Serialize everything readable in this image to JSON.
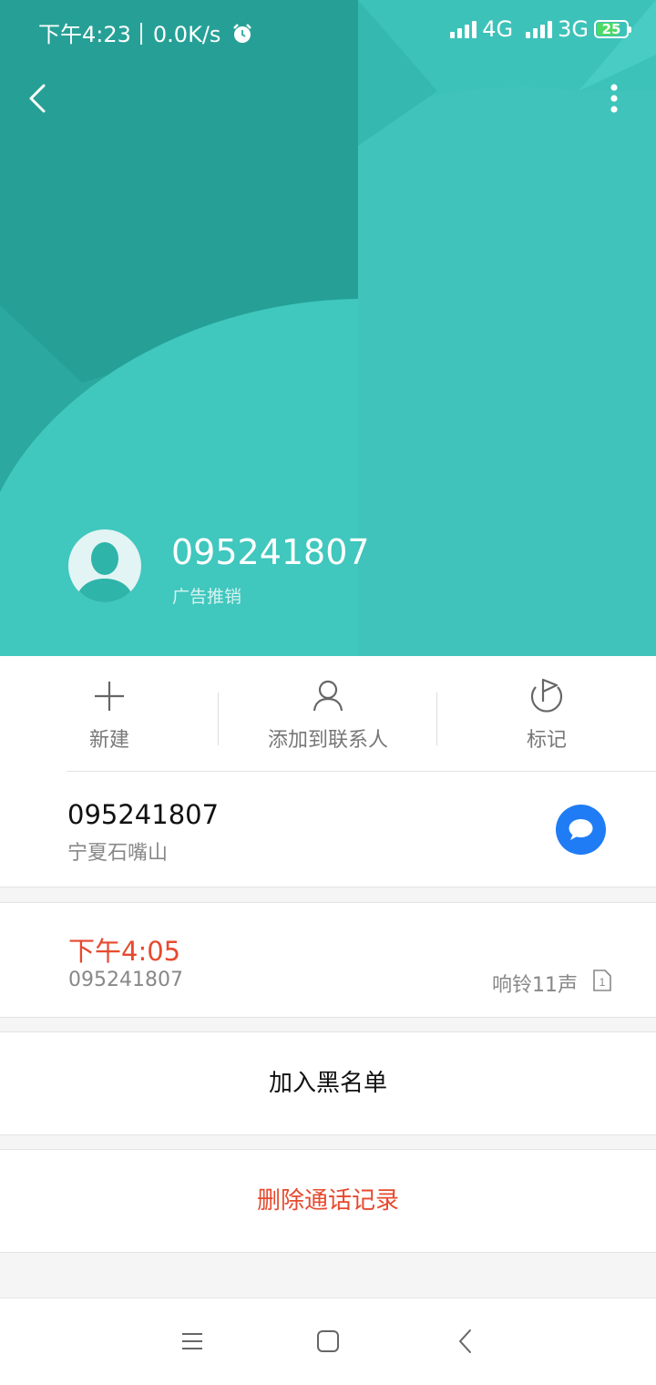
{
  "status_bar": {
    "time": "下午4:23",
    "net_speed": "0.0K/s",
    "network_1": "4G",
    "network_2": "3G",
    "battery": "25"
  },
  "header": {
    "number": "095241807",
    "tag": "广告推销"
  },
  "actions": [
    {
      "label": "新建",
      "icon": "plus-icon"
    },
    {
      "label": "添加到联系人",
      "icon": "person-icon"
    },
    {
      "label": "标记",
      "icon": "flag-icon"
    }
  ],
  "number_info": {
    "number": "095241807",
    "location": "宁夏石嘴山"
  },
  "call_record": {
    "time": "下午4:05",
    "number": "095241807",
    "ring_info": "响铃11声",
    "sim": "1"
  },
  "buttons": {
    "blacklist": "加入黑名单",
    "delete": "删除通话记录"
  },
  "colors": {
    "header_bg": "#3fbfb6",
    "accent_red": "#e64a2e",
    "message_blue": "#1f7cf5"
  }
}
